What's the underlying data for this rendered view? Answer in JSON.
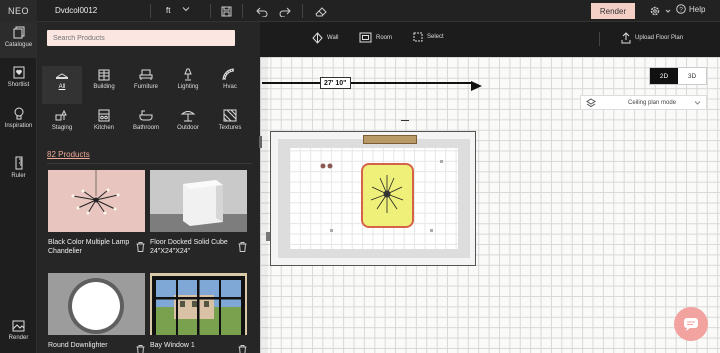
{
  "app": {
    "logo": "NEO",
    "project_name": "Dvdcol0012",
    "unit": "ft",
    "render_label": "Render",
    "help_label": "Help"
  },
  "colors": {
    "accent": "#f3cfc6",
    "link": "#f1a99a",
    "selection": "#d6624a"
  },
  "leftnav": {
    "items": [
      {
        "label": "Catalogue",
        "icon": "catalogue-icon"
      },
      {
        "label": "Shortlist",
        "icon": "shortlist-icon"
      },
      {
        "label": "Inspiration",
        "icon": "bulb-icon"
      },
      {
        "label": "Ruler",
        "icon": "ruler-icon"
      },
      {
        "label": "Render",
        "icon": "render-icon"
      }
    ]
  },
  "catalogue": {
    "search_placeholder": "Search Products",
    "categories": [
      "All",
      "Building",
      "Furniture",
      "Lighting",
      "Hvac",
      "Staging",
      "Kitchen",
      "Bathroom",
      "Outdoor",
      "Textures"
    ],
    "selected_category": "All",
    "count_label": "82 Products",
    "products": [
      {
        "title": "Black Color Multiple Lamp Chandelier"
      },
      {
        "title": "Floor Docked Solid Cube 24\"X24\"X24\""
      },
      {
        "title": "Round Downlighter"
      },
      {
        "title": "Bay Window 1"
      }
    ]
  },
  "canvas_toolbar": {
    "wall": "Wall",
    "room": "Room",
    "select": "Select",
    "upload": "Upload Floor Plan"
  },
  "view": {
    "mode_2d": "2D",
    "mode_3d": "3D",
    "active": "2D",
    "ceiling_mode": "Ceiling plan mode"
  },
  "dimension": {
    "label": "27' 10\""
  }
}
